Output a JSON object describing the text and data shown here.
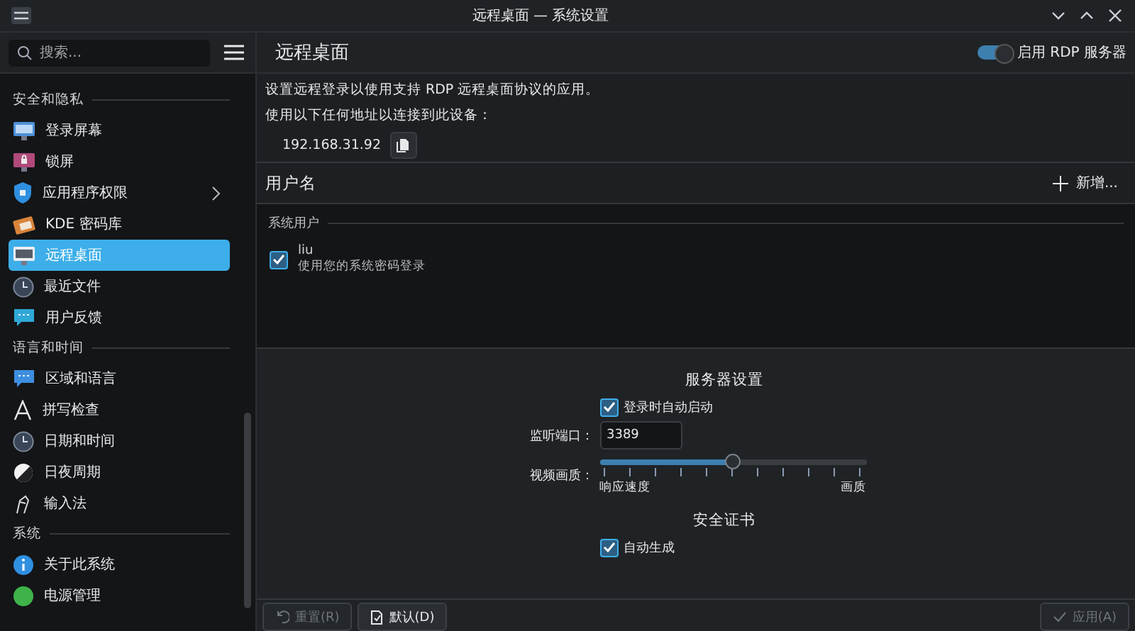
{
  "window": {
    "title": "远程桌面 — 系统设置"
  },
  "search": {
    "placeholder": "搜索..."
  },
  "sidebar": {
    "groups": [
      {
        "title": "安全和隐私",
        "items": [
          {
            "label": "登录屏幕",
            "selected": false,
            "submenu": false
          },
          {
            "label": "锁屏",
            "selected": false,
            "submenu": false
          },
          {
            "label": "应用程序权限",
            "selected": false,
            "submenu": true
          },
          {
            "label": "KDE 密码库",
            "selected": false,
            "submenu": false
          },
          {
            "label": "远程桌面",
            "selected": true,
            "submenu": false
          },
          {
            "label": "最近文件",
            "selected": false,
            "submenu": false
          },
          {
            "label": "用户反馈",
            "selected": false,
            "submenu": false
          }
        ]
      },
      {
        "title": "语言和时间",
        "items": [
          {
            "label": "区域和语言",
            "selected": false,
            "submenu": false
          },
          {
            "label": "拼写检查",
            "selected": false,
            "submenu": false
          },
          {
            "label": "日期和时间",
            "selected": false,
            "submenu": false
          },
          {
            "label": "日夜周期",
            "selected": false,
            "submenu": false
          },
          {
            "label": "输入法",
            "selected": false,
            "submenu": false
          }
        ]
      },
      {
        "title": "系统",
        "items": [
          {
            "label": "关于此系统",
            "selected": false,
            "submenu": false
          },
          {
            "label": "电源管理",
            "selected": false,
            "submenu": false
          }
        ]
      }
    ]
  },
  "page": {
    "title": "远程桌面",
    "enable_toggle": {
      "label": "启用 RDP 服务器",
      "on": true
    },
    "description": "设置远程登录以使用支持 RDP 远程桌面协议的应用。",
    "address_prompt": "使用以下任何地址以连接到此设备：",
    "address": "192.168.31.92"
  },
  "users": {
    "heading": "用户名",
    "add_button": "新增...",
    "section": "系统用户",
    "items": [
      {
        "name": "liu",
        "subtitle": "使用您的系统密码登录",
        "checked": true
      }
    ]
  },
  "server_settings": {
    "heading": "服务器设置",
    "autostart": {
      "label": "登录时自动启动",
      "checked": true
    },
    "port": {
      "label": "监听端口：",
      "value": "3389"
    },
    "quality": {
      "label": "视频画质：",
      "level": 0.5,
      "min_label": "响应速度",
      "max_label": "画质"
    }
  },
  "certificate": {
    "heading": "安全证书",
    "autogen": {
      "label": "自动生成",
      "checked": true
    }
  },
  "footer": {
    "buttons": [
      {
        "label": "重置(R)",
        "kind": "reset",
        "disabled": true
      },
      {
        "label": "默认(D)",
        "kind": "defaults",
        "disabled": false
      },
      {
        "label": "应用(A)",
        "kind": "apply",
        "disabled": true
      }
    ]
  }
}
